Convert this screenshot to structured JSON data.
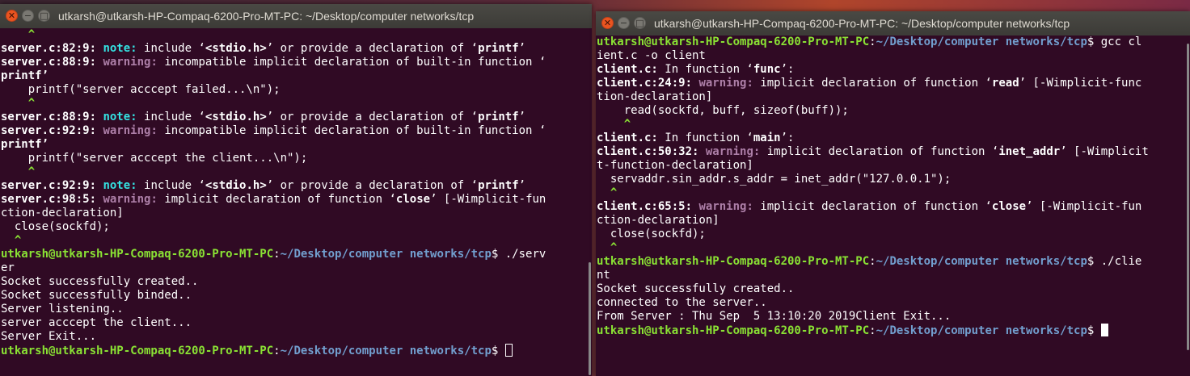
{
  "left_window": {
    "title": "utkarsh@utkarsh-HP-Compaq-6200-Pro-MT-PC: ~/Desktop/computer networks/tcp",
    "prompt_user": "utkarsh@utkarsh-HP-Compaq-6200-Pro-MT-PC",
    "prompt_path": "~/Desktop/computer networks/tcp",
    "lines": [
      "    ^",
      "server.c:82:9: note: include ‘<stdio.h>’ or provide a declaration of ‘printf’",
      "server.c:88:9: warning: incompatible implicit declaration of built-in function ‘",
      "printf’",
      "    printf(\"server acccept failed...\\n\");",
      "    ^",
      "server.c:88:9: note: include ‘<stdio.h>’ or provide a declaration of ‘printf’",
      "server.c:92:9: warning: incompatible implicit declaration of built-in function ‘",
      "printf’",
      "    printf(\"server acccept the client...\\n\");",
      "    ^",
      "server.c:92:9: note: include ‘<stdio.h>’ or provide a declaration of ‘printf’",
      "server.c:98:5: warning: implicit declaration of function ‘close’ [-Wimplicit-fun",
      "ction-declaration]",
      "  close(sockfd);",
      "  ^",
      "utkarsh@utkarsh-HP-Compaq-6200-Pro-MT-PC:~/Desktop/computer networks/tcp$ ./serv",
      "er",
      "Socket successfully created..",
      "Socket successfully binded..",
      "Server listening..",
      "server acccept the client...",
      "Server Exit...",
      "utkarsh@utkarsh-HP-Compaq-6200-Pro-MT-PC:~/Desktop/computer networks/tcp$"
    ]
  },
  "right_window": {
    "title": "utkarsh@utkarsh-HP-Compaq-6200-Pro-MT-PC: ~/Desktop/computer networks/tcp",
    "lines": [
      "utkarsh@utkarsh-HP-Compaq-6200-Pro-MT-PC:~/Desktop/computer networks/tcp$ gcc cl",
      "ient.c -o client",
      "client.c: In function ‘func’:",
      "client.c:24:9: warning: implicit declaration of function ‘read’ [-Wimplicit-func",
      "tion-declaration]",
      "    read(sockfd, buff, sizeof(buff));",
      "    ^",
      "client.c: In function ‘main’:",
      "client.c:50:32: warning: implicit declaration of function ‘inet_addr’ [-Wimplicit",
      "t-function-declaration]",
      "  servaddr.sin_addr.s_addr = inet_addr(\"127.0.0.1\");",
      "  ^",
      "client.c:65:5: warning: implicit declaration of function ‘close’ [-Wimplicit-fun",
      "ction-declaration]",
      "  close(sockfd);",
      "  ^",
      "utkarsh@utkarsh-HP-Compaq-6200-Pro-MT-PC:~/Desktop/computer networks/tcp$ ./clie",
      "nt",
      "Socket successfully created..",
      "connected to the server..",
      "From Server : Thu Sep  5 13:10:20 2019Client Exit...",
      "utkarsh@utkarsh-HP-Compaq-6200-Pro-MT-PC:~/Desktop/computer networks/tcp$"
    ]
  },
  "window_buttons": {
    "close": "✕",
    "minimize": "−",
    "maximize": "□"
  },
  "colors": {
    "terminal_bg": "#300a24",
    "prompt_user": "#8ae234",
    "prompt_path": "#729fcf",
    "warning": "#ad7fa8",
    "note": "#34e2e2",
    "caret": "#8ae234",
    "titlebar": "#3c3b37",
    "close_button": "#e95420"
  }
}
